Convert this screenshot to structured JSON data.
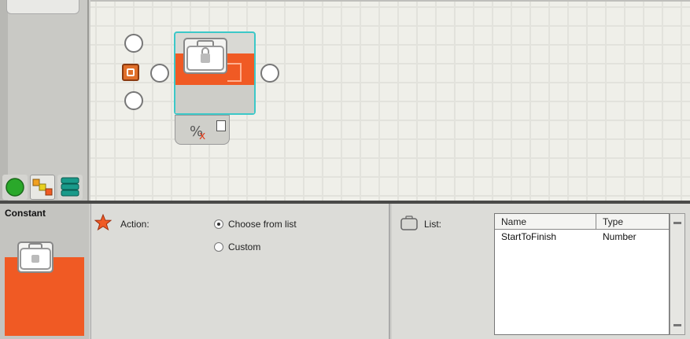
{
  "palette": {
    "tabs": [
      {
        "name": "common-palette",
        "icon": "green-circle-icon",
        "color": "#2aa82a"
      },
      {
        "name": "complete-palette",
        "icon": "blocks-icon",
        "color": "#f0a020"
      },
      {
        "name": "custom-palette",
        "icon": "stack-icon",
        "color": "#1a9a8a"
      }
    ]
  },
  "canvas": {
    "block_icon": "briefcase-icon",
    "hub_symbol": "%⁄x"
  },
  "config": {
    "block_name": "Constant",
    "action_label": "Action:",
    "options": [
      {
        "label": "Choose from list",
        "selected": true
      },
      {
        "label": "Custom",
        "selected": false
      }
    ],
    "list_label": "List:",
    "table": {
      "columns": [
        "Name",
        "Type"
      ],
      "rows": [
        {
          "name": "StartToFinish",
          "type": "Number"
        }
      ]
    }
  },
  "colors": {
    "accent_orange": "#f05a24",
    "selection": "#3cc8c8"
  }
}
